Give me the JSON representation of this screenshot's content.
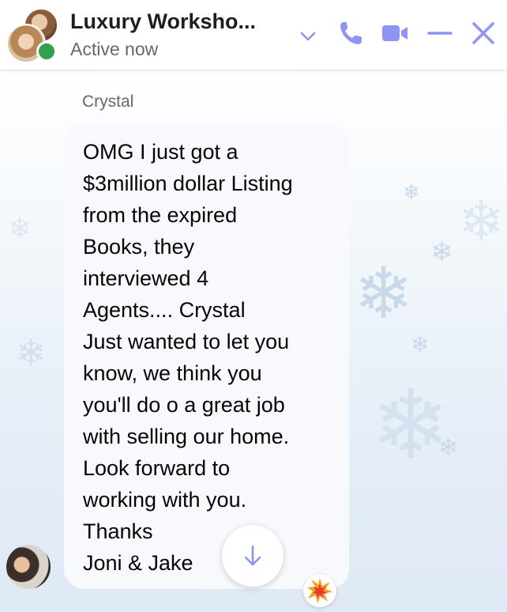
{
  "header": {
    "title": "Luxury Worksho...",
    "status": "Active now",
    "icons": [
      "chevron-down-icon",
      "phone-icon",
      "video-camera-icon",
      "minimize-icon",
      "close-icon"
    ],
    "accent_color": "#8f93f2"
  },
  "message": {
    "sender": "Crystal",
    "lines": [
      "OMG I just got a",
      "$3million dollar Listing",
      "from the expired",
      "Books, they",
      "interviewed 4",
      "Agents.... Crystal",
      "Just wanted to let you",
      "know, we think you",
      "you'll do o a great job",
      "with selling our home.",
      "Look forward to",
      "working with you.",
      "Thanks",
      "Joni & Jake"
    ],
    "reaction": "collision-emoji"
  },
  "colors": {
    "online": "#31a24c",
    "bubble": "#f7f9fc",
    "text": "#050505",
    "muted": "#65676b"
  }
}
